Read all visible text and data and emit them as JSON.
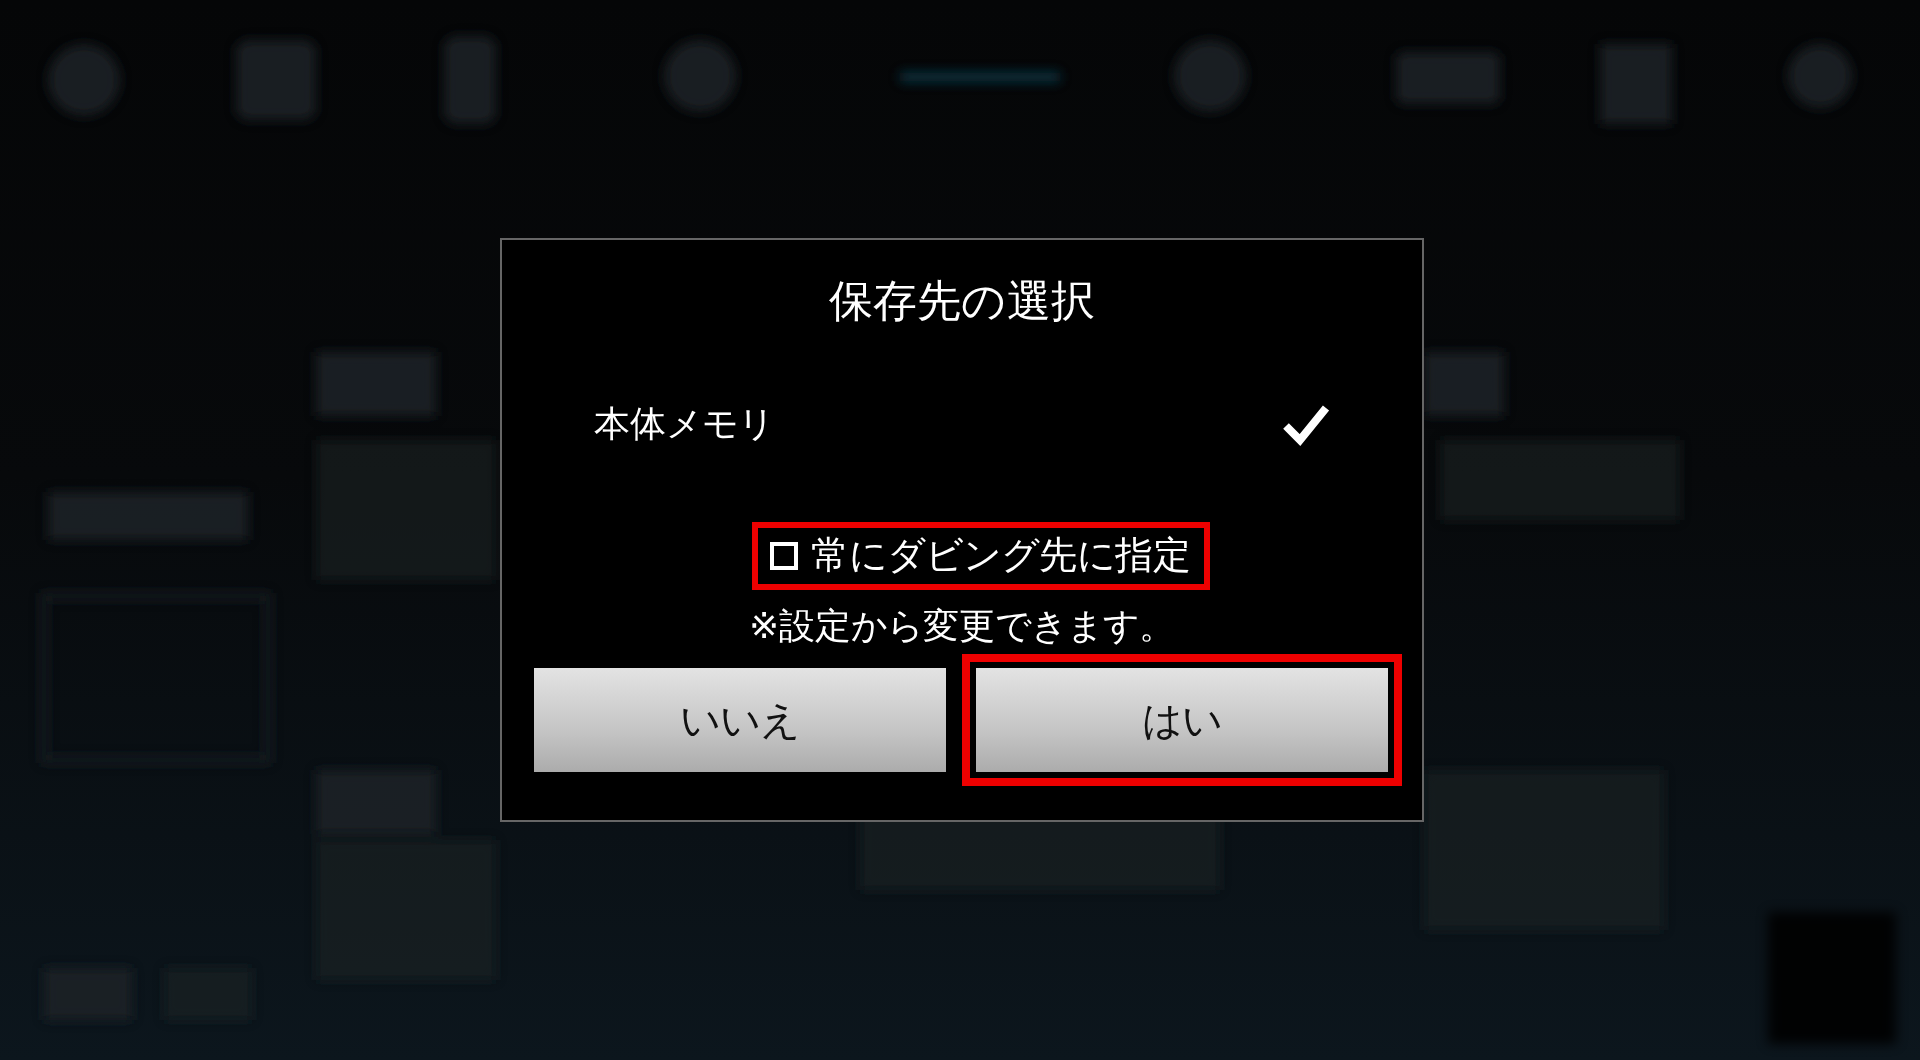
{
  "dialog": {
    "title": "保存先の選択",
    "options": [
      {
        "label": "本体メモリ",
        "selected": true
      }
    ],
    "checkbox": {
      "label": "常にダビング先に指定",
      "checked": false,
      "highlighted": true
    },
    "note": "※設定から変更できます。",
    "buttons": [
      {
        "label": "いいえ",
        "highlighted": false
      },
      {
        "label": "はい",
        "highlighted": true
      }
    ]
  }
}
